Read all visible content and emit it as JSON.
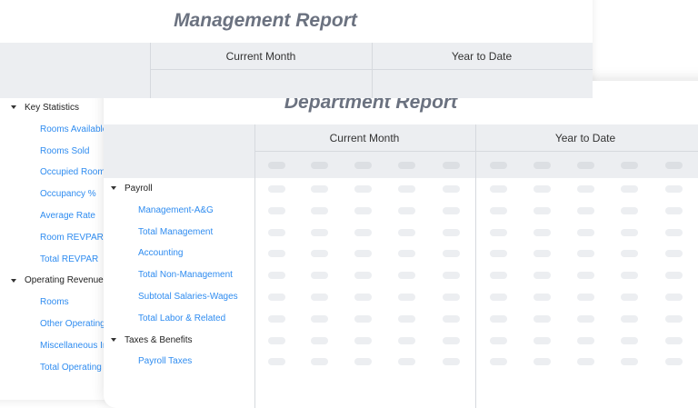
{
  "management_report": {
    "title": "Management Report",
    "columns": [
      "Current Month",
      "Year to Date"
    ],
    "rows": [
      {
        "type": "group",
        "label": "Key Statistics"
      },
      {
        "type": "item",
        "label": "Rooms Available"
      },
      {
        "type": "item",
        "label": "Rooms Sold"
      },
      {
        "type": "item",
        "label": "Occupied Rooms"
      },
      {
        "type": "item",
        "label": "Occupancy %"
      },
      {
        "type": "item",
        "label": "Average Rate"
      },
      {
        "type": "item",
        "label": "Room REVPAR"
      },
      {
        "type": "item",
        "label": "Total REVPAR"
      },
      {
        "type": "group",
        "label": "Operating Revenue"
      },
      {
        "type": "item",
        "label": "Rooms"
      },
      {
        "type": "item",
        "label": "Other Operating"
      },
      {
        "type": "item",
        "label": "Miscellaneous Income"
      },
      {
        "type": "item",
        "label": "Total Operating Revenue"
      }
    ]
  },
  "department_report": {
    "title": "Department Report",
    "columns": [
      "Current Month",
      "Year to Date"
    ],
    "rows": [
      {
        "type": "group",
        "label": "Payroll"
      },
      {
        "type": "item",
        "label": "Management-A&G"
      },
      {
        "type": "item",
        "label": "Total Management"
      },
      {
        "type": "item",
        "label": "Accounting"
      },
      {
        "type": "item",
        "label": "Total Non-Management"
      },
      {
        "type": "item",
        "label": "Subtotal Salaries-Wages"
      },
      {
        "type": "item",
        "label": "Total Labor & Related"
      },
      {
        "type": "group",
        "label": "Taxes & Benefits"
      },
      {
        "type": "item",
        "label": "Payroll Taxes"
      }
    ]
  }
}
